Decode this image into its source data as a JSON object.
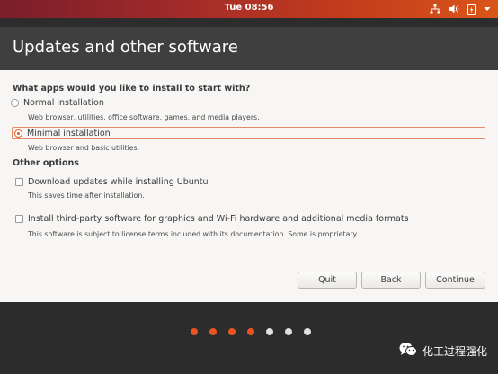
{
  "topbar": {
    "clock": "Tue 08:56",
    "icons": [
      "network-icon",
      "volume-icon",
      "battery-icon",
      "chevron-down-icon"
    ]
  },
  "window": {
    "title": "Updates and other software",
    "question": "What apps would you like to install to start with?",
    "options": [
      {
        "label": "Normal installation",
        "description": "Web browser, utilities, office software, games, and media players.",
        "selected": false
      },
      {
        "label": "Minimal installation",
        "description": "Web browser and basic utilities.",
        "selected": true
      }
    ],
    "other_options_heading": "Other options",
    "checkboxes": [
      {
        "label": "Download updates while installing Ubuntu",
        "description": "This saves time after installation.",
        "checked": false
      },
      {
        "label": "Install third-party software for graphics and Wi-Fi hardware and additional media formats",
        "description": "This software is subject to license terms included with its documentation. Some is proprietary.",
        "checked": false
      }
    ],
    "buttons": {
      "quit": "Quit",
      "back": "Back",
      "continue": "Continue"
    }
  },
  "progress": {
    "total_steps": 7,
    "completed_steps": 4,
    "active_color": "#e95420",
    "inactive_color": "#e0e0e0"
  },
  "watermark": {
    "text": "化工过程强化"
  },
  "colors": {
    "accent": "#e95420",
    "header_bg": "#3f3f3f",
    "content_bg": "#f7f6f5"
  }
}
